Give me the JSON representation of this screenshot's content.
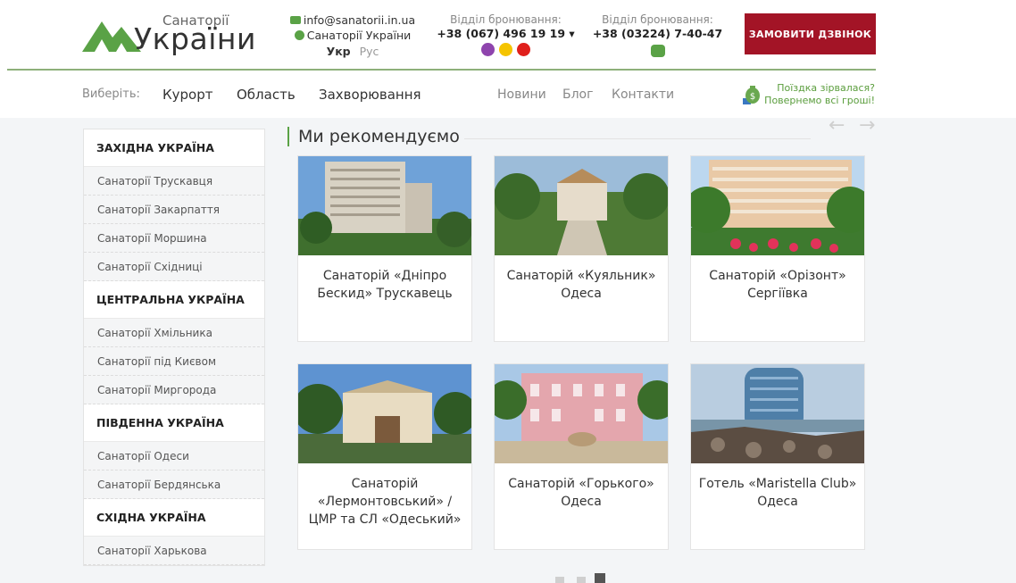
{
  "header": {
    "logo": {
      "top_text": "Санаторії",
      "main_text": "України"
    },
    "email": "info@sanatorii.in.ua",
    "skype": "Санаторії України",
    "lang": {
      "active": "Укр",
      "inactive": "Рус"
    },
    "booking1": {
      "label": "Відділ бронювання:",
      "phone": "+38 (067) 496 19 19 ▾"
    },
    "booking2": {
      "label": "Відділ бронювання:",
      "phone": "+38 (03224) 7-40-47"
    },
    "callback_button": "ЗАМОВИТИ ДЗВІНОК"
  },
  "nav": {
    "label": "Виберіть:",
    "main": [
      "Курорт",
      "Область",
      "Захворювання"
    ],
    "secondary": [
      "Новини",
      "Блог",
      "Контакти"
    ],
    "refund": {
      "line1": "Поїздка зірвалася?",
      "line2": "Повернемо всі гроші!"
    }
  },
  "sidebar": {
    "sections": [
      {
        "title": "ЗАХІДНА УКРАЇНА",
        "items": [
          "Санаторії Трускавця",
          "Санаторії Закарпаття",
          "Санаторії Моршина",
          "Санаторії Східниці"
        ]
      },
      {
        "title": "ЦЕНТРАЛЬНА УКРАЇНА",
        "items": [
          "Санаторії Хмільника",
          "Санаторії під Києвом",
          "Санаторії Миргорода"
        ]
      },
      {
        "title": "ПІВДЕННА УКРАЇНА",
        "items": [
          "Санаторії Одеси",
          "Санаторії Бердянська"
        ]
      },
      {
        "title": "СХІДНА УКРАЇНА",
        "items": [
          "Санаторії Харькова"
        ]
      }
    ]
  },
  "main": {
    "title": "Ми рекомендуємо",
    "arrows": {
      "prev": "←",
      "next": "→"
    },
    "cards": [
      {
        "caption": "Санаторій «Дніпро Бескид» Трускавець"
      },
      {
        "caption": "Санаторій «Куяльник» Одеса"
      },
      {
        "caption": "Санаторій «Орізонт» Сергіївка"
      },
      {
        "caption": "Санаторій «Лермонтовський» / ЦМР та СЛ «Одеський»"
      },
      {
        "caption": "Санаторій «Горького» Одеса"
      },
      {
        "caption": "Готель «Maristella Club» Одеса"
      }
    ]
  },
  "colors": {
    "accent_green": "#5aa246",
    "cta_red": "#a31426"
  }
}
